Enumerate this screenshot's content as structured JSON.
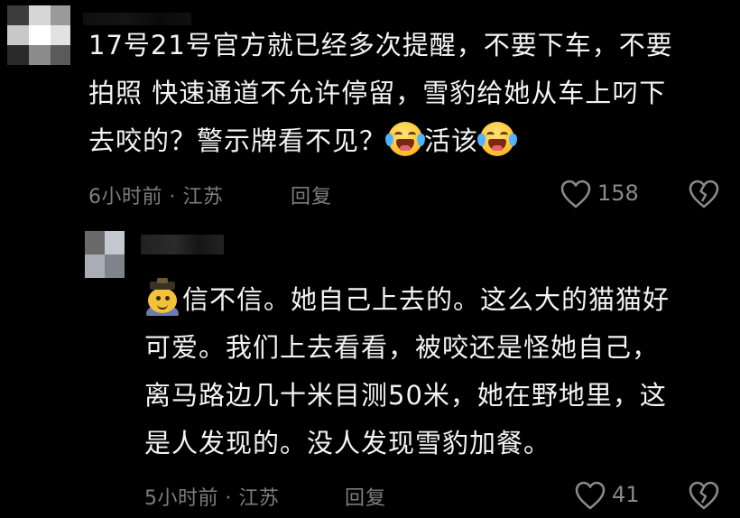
{
  "comments": [
    {
      "lines": [
        "17号21号官方就已经多次提醒，不要下车，不要",
        "拍照 快速通道不允许停留，雪豹给她从车上叼下",
        "去咬的？警示牌看不见？",
        "活该"
      ],
      "emoji": "loudly-crying-face-icon",
      "meta": "6小时前 · 江苏",
      "reply_label": "回复",
      "like_count": "158"
    },
    {
      "lines": [
        "信不信。她自己上去的。这么大的猫猫好",
        "可爱。我们上去看看，被咬还是怪她自己，",
        "离马路边几十米目测50米，她在野地里，这",
        "是人发现的。没人发现雪豹加餐。"
      ],
      "sticker": "graduate-sticker-icon",
      "meta": "5小时前 · 江苏",
      "reply_label": "回复",
      "like_count": "41"
    }
  ],
  "colors": {
    "background": "#000000",
    "text": "#f4f4f4",
    "meta": "#7d7d7d"
  }
}
